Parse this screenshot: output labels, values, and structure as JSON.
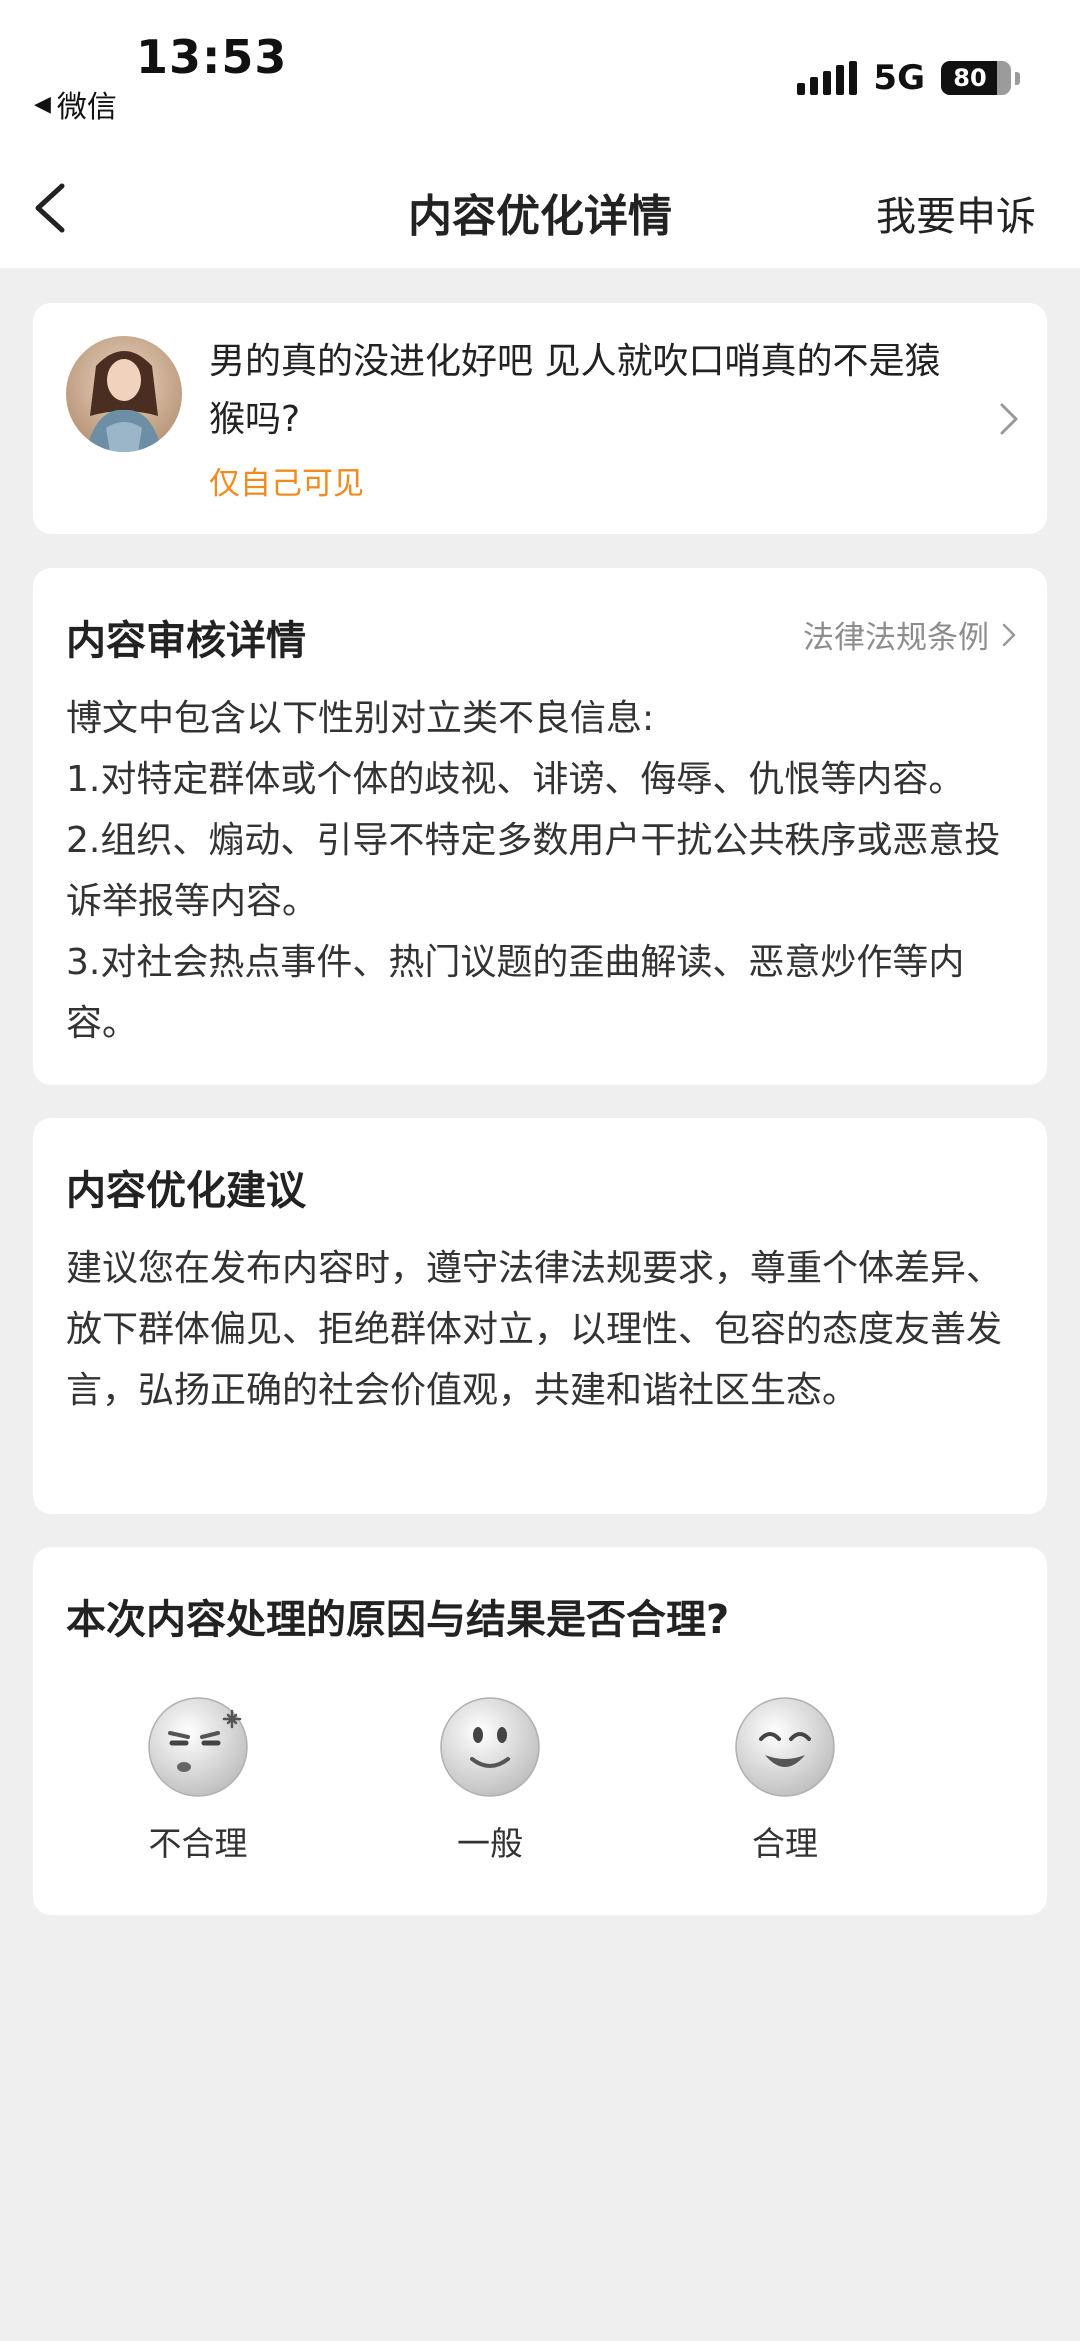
{
  "status_bar": {
    "time": "13:53",
    "back_app": "微信",
    "network": "5G",
    "battery": "80"
  },
  "nav": {
    "title": "内容优化详情",
    "appeal": "我要申诉"
  },
  "post": {
    "text": "男的真的没进化好吧 见人就吹口哨真的不是猿猴吗?",
    "visibility": "仅自己可见"
  },
  "review": {
    "title": "内容审核详情",
    "law_link": "法律法规条例",
    "lines": [
      "博文中包含以下性别对立类不良信息:",
      "1.对特定群体或个体的歧视、诽谤、侮辱、仇恨等内容。",
      "2.组织、煽动、引导不特定多数用户干扰公共秩序或恶意投诉举报等内容。",
      "3.对社会热点事件、热门议题的歪曲解读、恶意炒作等内容。"
    ]
  },
  "suggestion": {
    "title": "内容优化建议",
    "text": "建议您在发布内容时，遵守法律法规要求，尊重个体差异、放下群体偏见、拒绝群体对立，以理性、包容的态度友善发言，弘扬正确的社会价值观，共建和谐社区生态。"
  },
  "feedback": {
    "question": "本次内容处理的原因与结果是否合理?",
    "options": [
      {
        "label": "不合理",
        "icon": "annoyed-face-icon"
      },
      {
        "label": "一般",
        "icon": "neutral-face-icon"
      },
      {
        "label": "合理",
        "icon": "happy-face-icon"
      }
    ]
  },
  "colors": {
    "accent_orange": "#f08c1e",
    "background": "#efefef",
    "card": "#ffffff"
  }
}
